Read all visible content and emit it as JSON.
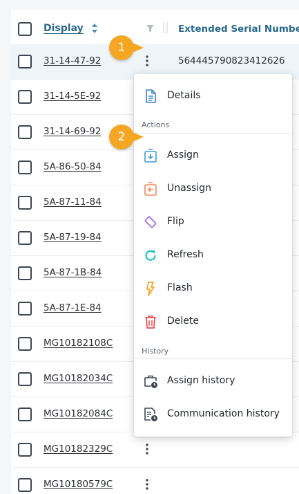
{
  "header": {
    "display_label": "Display",
    "serial_label": "Extended Serial Number"
  },
  "rows": [
    {
      "display": "31-14-47-92",
      "serial": "564445790823412626"
    },
    {
      "display": "31-14-5E-92",
      "serial": ""
    },
    {
      "display": "31-14-69-92",
      "serial": ""
    },
    {
      "display": "5A-86-50-84",
      "serial": ""
    },
    {
      "display": "5A-87-11-84",
      "serial": ""
    },
    {
      "display": "5A-87-19-84",
      "serial": ""
    },
    {
      "display": "5A-87-1B-84",
      "serial": ""
    },
    {
      "display": "5A-87-1E-84",
      "serial": ""
    },
    {
      "display": "MG10182108C",
      "serial": ""
    },
    {
      "display": "MG10182034C",
      "serial": ""
    },
    {
      "display": "MG10182084C",
      "serial": ""
    },
    {
      "display": "MG10182329C",
      "serial": ""
    },
    {
      "display": "MG10180579C",
      "serial": ""
    }
  ],
  "menu": {
    "details": "Details",
    "actions_heading": "Actions",
    "assign": "Assign",
    "unassign": "Unassign",
    "flip": "Flip",
    "refresh": "Refresh",
    "flash": "Flash",
    "delete": "Delete",
    "history_heading": "History",
    "assign_history": "Assign history",
    "communication_history": "Communication history"
  },
  "callouts": {
    "one": "1",
    "two": "2"
  },
  "icons": {
    "details": "document-icon",
    "assign": "assign-icon",
    "unassign": "unassign-icon",
    "flip": "flip-icon",
    "refresh": "refresh-icon",
    "flash": "flash-icon",
    "delete": "trash-icon",
    "assign_history": "briefcase-clock-icon",
    "communication_history": "document-clock-icon"
  },
  "colors": {
    "link": "#2b6a8c",
    "callout": "#f5a623",
    "details": "#3b82c4",
    "assign": "#3b9bd6",
    "unassign": "#f08a5d",
    "flip": "#a46fe8",
    "refresh": "#1fc1c6",
    "flash": "#f5a623",
    "delete": "#e64b4b"
  }
}
